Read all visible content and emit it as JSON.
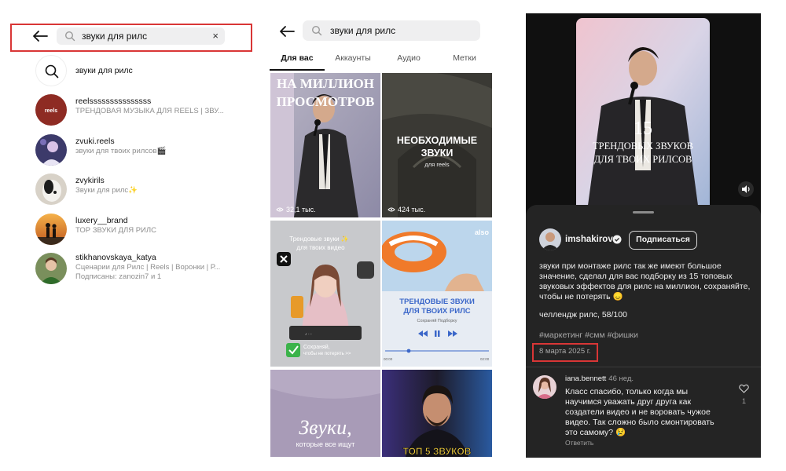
{
  "panel1": {
    "search_query": "звуки для рилс",
    "clear_glyph": "×",
    "results": [
      {
        "name": "звуки для рилс",
        "sub": ""
      },
      {
        "name": "reelsssssssssssssss",
        "sub": "ТРЕНДОВАЯ МУЗЫКА ДЛЯ REELS | ЗВУ...",
        "avatar_text": "reels"
      },
      {
        "name": "zvuki.reels",
        "sub": "звуки для твоих рилсов🎬"
      },
      {
        "name": "zvykirils",
        "sub": "Звуки для рилс✨"
      },
      {
        "name": "luxery__brand",
        "sub": "ТОР ЗВУКИ ДЛЯ РИЛС"
      },
      {
        "name": "stikhanovskaya_katya",
        "sub": "Сценарии для Рилс | Reels | Воронки | Р...",
        "sub2": "Подписаны: zanozin7 и 1"
      }
    ]
  },
  "panel2": {
    "search_query": "звуки для рилс",
    "tabs": [
      "Для вас",
      "Аккаунты",
      "Аудио",
      "Метки"
    ],
    "tiles": [
      {
        "line1": "НА МИЛЛИОН",
        "line2": "ПРОСМОТРОВ",
        "views": "32,1 тыс."
      },
      {
        "line1": "НЕОБХОДИМЫЕ",
        "line2": "ЗВУКИ",
        "line3": "для reels",
        "views": "424 тыс."
      },
      {
        "line1": "Трендовые звуки ✨",
        "line2": "для твоих видео",
        "saved1": "Сохраняй,",
        "saved2": "чтобы не потерять >>"
      },
      {
        "brand": "also",
        "line1": "ТРЕНДОВЫЕ ЗВУКИ",
        "line2": "ДЛЯ ТВОИХ РИЛС",
        "line3": "Сохраняй Подборку",
        "t1": "00:00",
        "t2": "02:00"
      },
      {
        "line1": "Звуки,",
        "line2": "которые все ищут"
      },
      {
        "line1": "ТОП 5 ЗВУКОВ"
      }
    ]
  },
  "panel3": {
    "video_title_num": "15",
    "video_title_l1": "ТРЕНДОВЫХ ЗВУКОВ",
    "video_title_l2": "ДЛЯ ТВОИХ РИЛСОВ",
    "username": "imshakirov",
    "follow_label": "Подписаться",
    "caption": "звуки при монтаже рилс так же имеют большое значение, сделал для вас подборку из 15 топовых звуковых эффектов для рилс на миллион, сохраняйте, чтобы не потерять 😞",
    "challenge": "челлендж рилс, 58/100",
    "tags": "#маркетинг #смм #фишки",
    "date": "8 марта 2025 г.",
    "comment": {
      "user": "iana.bennett",
      "time": "46 нед.",
      "text": "Класс спасибо, только когда мы научимся уважать друг друга как создатели видео и не воровать чужое видео. Так сложно было смонтировать это самому? 😢",
      "reply_label": "Ответить",
      "likes": "1"
    }
  }
}
